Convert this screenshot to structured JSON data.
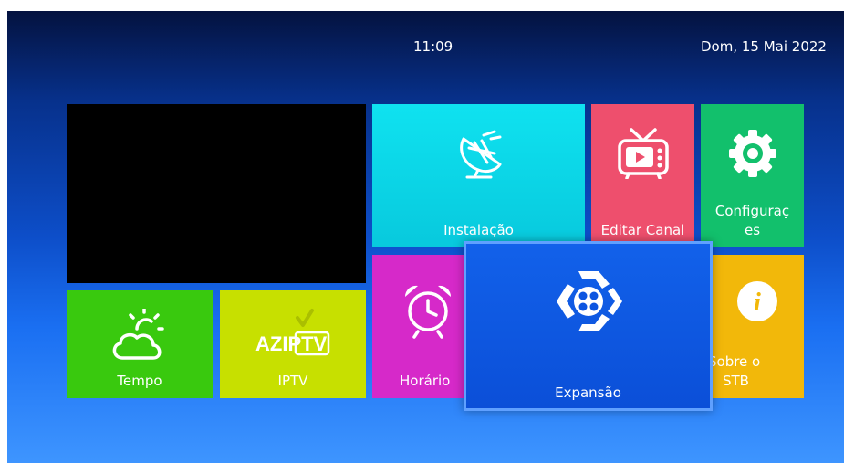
{
  "header": {
    "time": "11:09",
    "date": "Dom, 15 Mai 2022"
  },
  "tiles": {
    "instalacao": {
      "label": "Instalação",
      "icon": "satellite-dish-icon",
      "color": "#0fd8ea"
    },
    "editar_canal": {
      "label": "Editar Canal",
      "icon": "tv-icon",
      "color": "#ee4f6d"
    },
    "configuracoes": {
      "label": "Configuraç\nes",
      "label_line1": "Configuraç",
      "label_line2": "es",
      "icon": "gear-icon",
      "color": "#12c06c"
    },
    "tempo": {
      "label": "Tempo",
      "icon": "weather-icon",
      "color": "#39c90e"
    },
    "iptv": {
      "label": "IPTV",
      "logo_text": "AZIPTV",
      "icon": "aziptv-logo",
      "color": "#c7e000"
    },
    "horario": {
      "label": "Horário",
      "icon": "alarm-clock-icon",
      "color": "#d629c9"
    },
    "expansao": {
      "label": "Expansão",
      "icon": "expansion-icon",
      "color": "#0d55e0",
      "selected": true
    },
    "sobre": {
      "label_line1": "Sobre o",
      "label_line2": "STB",
      "icon": "info-icon",
      "color": "#f2b80a"
    }
  }
}
